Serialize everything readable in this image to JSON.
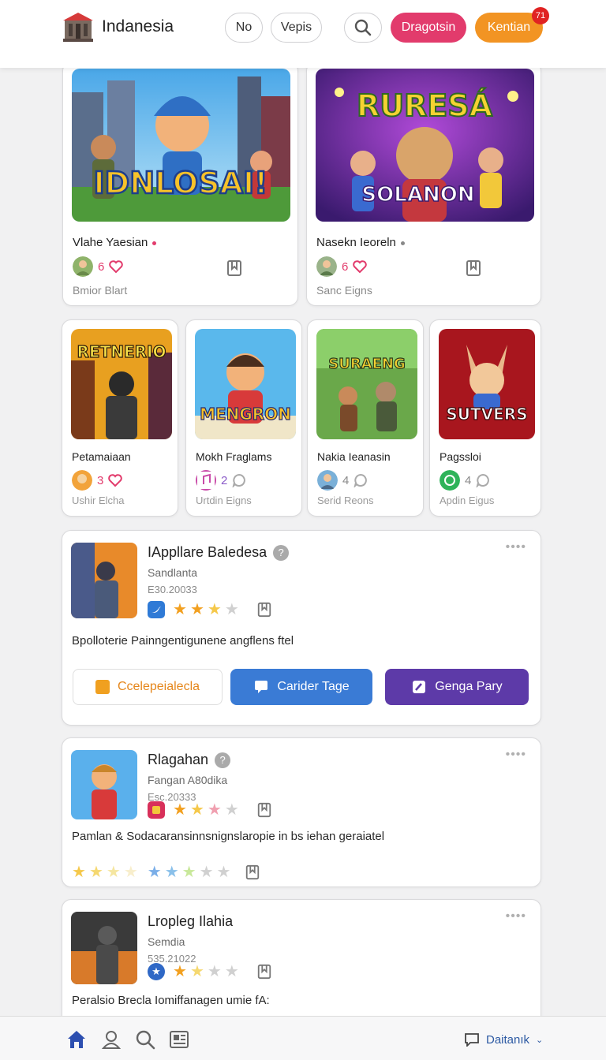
{
  "header": {
    "title": "Indanesia",
    "pill_no": "No",
    "pill_vepis": "Vepis",
    "btn_dragotsin": "Dragotsin",
    "btn_kentian": "Kentian",
    "notification_count": "71"
  },
  "featured": [
    {
      "art_text": "IDNLOSAI!",
      "name": "Vlahe Yaesian",
      "count": "6",
      "sub": "Bmior Blart"
    },
    {
      "art_text_top": "RURESÁ",
      "art_text_bottom": "SOLANON",
      "name": "Nasekn Ieoreln",
      "count": "6",
      "sub": "Sanc Eigns"
    }
  ],
  "small_cards": [
    {
      "art_text": "RETNERIO",
      "name": "Petamaiaan",
      "count": "3",
      "sub": "Ushir Elcha"
    },
    {
      "art_text": "MENGRON",
      "name": "Mokh Fraglams",
      "count": "2",
      "sub": "Urtdin Eigns"
    },
    {
      "art_text": "SURAENG",
      "name": "Nakia Ieanasin",
      "count": "4",
      "sub": "Serid Reons"
    },
    {
      "art_text": "SUTVERS",
      "name": "Pagssloi",
      "count": "4",
      "sub": "Apdin Eigus"
    }
  ],
  "list": [
    {
      "title": "IAppllare Baledesa",
      "subtitle": "Sandlanta",
      "code": "E30.20033",
      "rating": 3,
      "description": "Bpolloterie Painngentigunene angflens ftel",
      "actions": [
        "Ccelepeialecla",
        "Carider Tage",
        "Genga Pary"
      ]
    },
    {
      "title": "Rlagahan",
      "subtitle": "Fangan A80dika",
      "code": "Esc.20333",
      "rating": 3,
      "description": "Pamlan & Sodacaransinnsnignslaropie in bs iehan geraiatel"
    },
    {
      "title": "Lropleg Ilahia",
      "subtitle": "Semdia",
      "code": "535.21022",
      "rating": 2,
      "description": "Peralsio Brecla Iomiffanagen umie fA:"
    }
  ],
  "bottom_nav": {
    "right_label": "Daitanık"
  },
  "colors": {
    "accent_pink": "#e23b6c",
    "accent_orange": "#f29423",
    "action_blue": "#3a7bd5",
    "action_purple": "#5d3aa8"
  }
}
